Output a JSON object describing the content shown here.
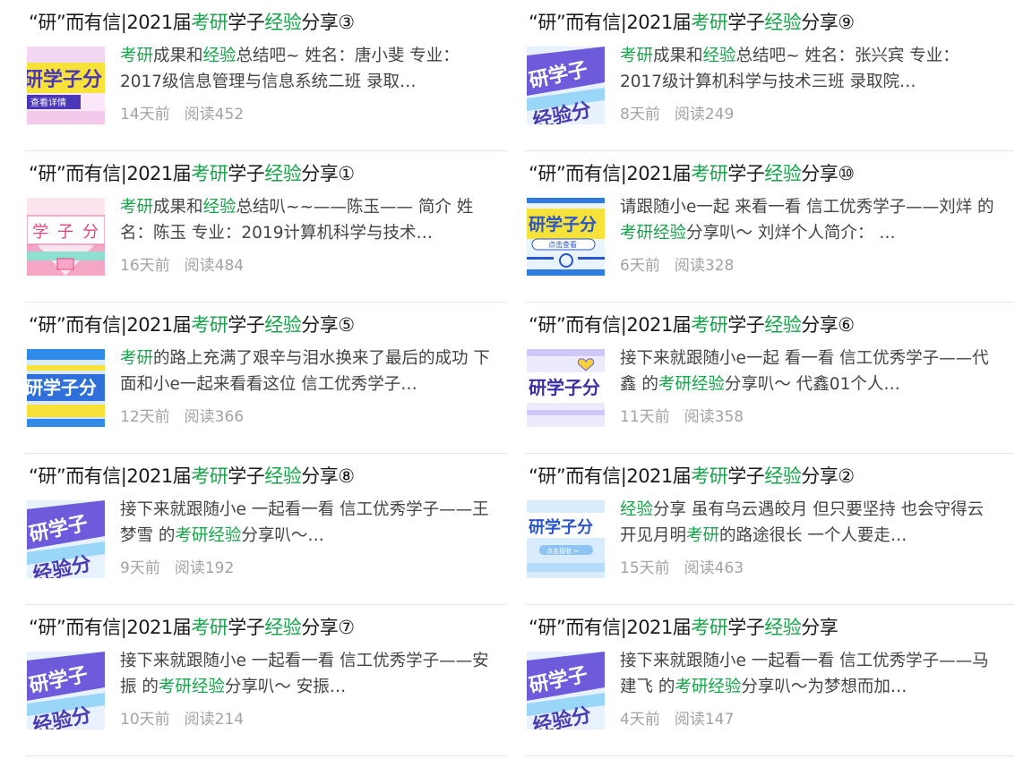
{
  "colors": {
    "highlight": "#17a54a",
    "meta": "#a3a3a3",
    "divider": "#e6e6e6"
  },
  "title_common": {
    "prefix": "“研”而有信|2021届",
    "kaoyan": "考研",
    "xuezi": "学子",
    "jingyan": "经验",
    "fenxiang": "分享"
  },
  "articles": [
    {
      "title_suffix": "③",
      "summary_parts": [
        {
          "text": "考研",
          "hl": true
        },
        {
          "text": "成果和",
          "hl": false
        },
        {
          "text": "经验",
          "hl": true
        },
        {
          "text": "总结吧~ 姓名：唐小斐 专业：2017级信息管理与信息系统二班 录取…",
          "hl": false
        }
      ],
      "time": "14天前",
      "reads": "阅读452",
      "thumb_icon": "thumb-pink-banner"
    },
    {
      "title_suffix": "⑨",
      "summary_parts": [
        {
          "text": "考研",
          "hl": true
        },
        {
          "text": "成果和",
          "hl": false
        },
        {
          "text": "经验",
          "hl": true
        },
        {
          "text": "总结吧~ 姓名：张兴宾 专业：2017级计算机科学与技术三班 录取院…",
          "hl": false
        }
      ],
      "time": "8天前",
      "reads": "阅读249",
      "thumb_icon": "thumb-purple-diagonal"
    },
    {
      "title_suffix": "①",
      "summary_parts": [
        {
          "text": "考研",
          "hl": true
        },
        {
          "text": "成果和",
          "hl": false
        },
        {
          "text": "经验",
          "hl": true
        },
        {
          "text": "总结叭~~——陈玉—— 简介 姓名：陈玉 专业：2019计算机科学与技术…",
          "hl": false
        }
      ],
      "time": "16天前",
      "reads": "阅读484",
      "thumb_icon": "thumb-pink-rays"
    },
    {
      "title_suffix": "⑩",
      "summary_parts": [
        {
          "text": "请跟随小e一起 来看一看 信工优秀学子——刘烊 的",
          "hl": false
        },
        {
          "text": "考研",
          "hl": true
        },
        {
          "text": "经验",
          "hl": true
        },
        {
          "text": "分享叭～ 刘烊个人简介： …",
          "hl": false
        }
      ],
      "time": "6天前",
      "reads": "阅读328",
      "thumb_icon": "thumb-yellow-search"
    },
    {
      "title_suffix": "⑤",
      "summary_parts": [
        {
          "text": "考研",
          "hl": true
        },
        {
          "text": "的路上充满了艰辛与泪水换来了最后的成功 下面和小e一起来看看这位 信工优秀学子…",
          "hl": false
        }
      ],
      "time": "12天前",
      "reads": "阅读366",
      "thumb_icon": "thumb-yellow-blue-stripes"
    },
    {
      "title_suffix": "⑥",
      "summary_parts": [
        {
          "text": "接下来就跟随小e一起 看一看 信工优秀学子——代鑫 的",
          "hl": false
        },
        {
          "text": "考研",
          "hl": true
        },
        {
          "text": "经验",
          "hl": true
        },
        {
          "text": "分享叭～ 代鑫01个人…",
          "hl": false
        }
      ],
      "time": "11天前",
      "reads": "阅读358",
      "thumb_icon": "thumb-lavender-heart"
    },
    {
      "title_suffix": "⑧",
      "summary_parts": [
        {
          "text": "接下来就跟随小e 一起看一看 信工优秀学子——王梦雪 的",
          "hl": false
        },
        {
          "text": "考研",
          "hl": true
        },
        {
          "text": "经验",
          "hl": true
        },
        {
          "text": "分享叭～…",
          "hl": false
        }
      ],
      "time": "9天前",
      "reads": "阅读192",
      "thumb_icon": "thumb-purple-diagonal"
    },
    {
      "title_suffix": "②",
      "summary_parts": [
        {
          "text": "经验",
          "hl": true
        },
        {
          "text": "分享 虽有乌云遇皎月 但只要坚持 也会守得云开见月明",
          "hl": false
        },
        {
          "text": "考研",
          "hl": true
        },
        {
          "text": "的路途很长 一个人要走…",
          "hl": false
        }
      ],
      "time": "15天前",
      "reads": "阅读463",
      "thumb_icon": "thumb-lightblue-banner"
    },
    {
      "title_suffix": "⑦",
      "summary_parts": [
        {
          "text": "接下来就跟随小e 一起看一看 信工优秀学子——安振 的",
          "hl": false
        },
        {
          "text": "考研",
          "hl": true
        },
        {
          "text": "经验",
          "hl": true
        },
        {
          "text": "分享叭～ 安振…",
          "hl": false
        }
      ],
      "time": "10天前",
      "reads": "阅读214",
      "thumb_icon": "thumb-purple-diagonal"
    },
    {
      "title_suffix": "",
      "summary_parts": [
        {
          "text": "接下来就跟随小e 一起看一看 信工优秀学子——马建飞 的",
          "hl": false
        },
        {
          "text": "考研",
          "hl": true
        },
        {
          "text": "经验",
          "hl": true
        },
        {
          "text": "分享叭～为梦想而加…",
          "hl": false
        }
      ],
      "time": "4天前",
      "reads": "阅读147",
      "thumb_icon": "thumb-purple-diagonal"
    }
  ],
  "thumb_text": {
    "main": "研学子分",
    "short": "研学子",
    "jingyan_fen": "经验分",
    "xue_zi_fen": [
      "学",
      "子",
      "分"
    ],
    "view_more": "查看详情",
    "click_view": "点击查看",
    "click_receive": "点击接收 >"
  }
}
